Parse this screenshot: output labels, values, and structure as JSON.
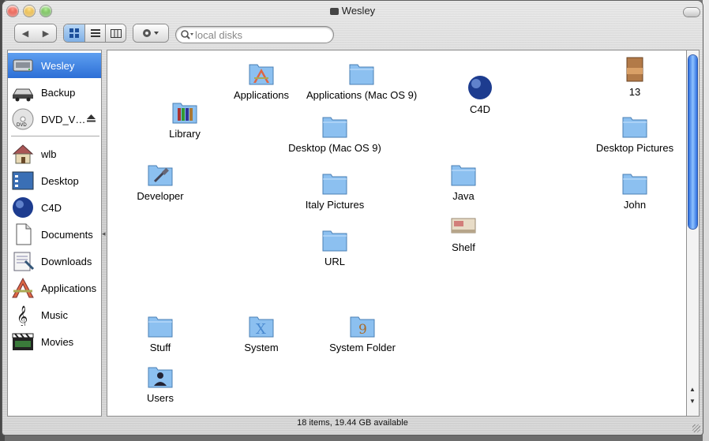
{
  "window": {
    "title": "Wesley"
  },
  "toolbar": {
    "back_label": "◀",
    "forward_label": "▶",
    "search_placeholder": "local disks"
  },
  "sidebar": {
    "devices": [
      {
        "label": "Wesley",
        "icon": "hard-drive-icon",
        "selected": true
      },
      {
        "label": "Backup",
        "icon": "external-drive-icon"
      },
      {
        "label": "DVD_V…",
        "icon": "dvd-icon",
        "ejectable": true
      }
    ],
    "places": [
      {
        "label": "wlb",
        "icon": "home-icon"
      },
      {
        "label": "Desktop",
        "icon": "desktop-icon"
      },
      {
        "label": "C4D",
        "icon": "c4d-icon"
      },
      {
        "label": "Documents",
        "icon": "documents-icon"
      },
      {
        "label": "Downloads",
        "icon": "downloads-icon"
      },
      {
        "label": "Applications",
        "icon": "applications-icon"
      },
      {
        "label": "Music",
        "icon": "music-icon"
      },
      {
        "label": "Movies",
        "icon": "movies-icon"
      }
    ]
  },
  "files": [
    {
      "label": "Applications",
      "icon": "applications-folder-icon"
    },
    {
      "label": "Applications (Mac OS 9)",
      "icon": "folder-icon"
    },
    {
      "label": "C4D",
      "icon": "c4d-icon"
    },
    {
      "label": "13",
      "icon": "image-file-icon"
    },
    {
      "label": "Library",
      "icon": "library-folder-icon"
    },
    {
      "label": "Desktop (Mac OS 9)",
      "icon": "folder-icon"
    },
    {
      "label": "Desktop Pictures",
      "icon": "folder-icon"
    },
    {
      "label": "Developer",
      "icon": "developer-folder-icon"
    },
    {
      "label": "Italy Pictures",
      "icon": "folder-icon"
    },
    {
      "label": "Java",
      "icon": "folder-icon"
    },
    {
      "label": "John",
      "icon": "folder-icon"
    },
    {
      "label": "Shelf",
      "icon": "shelf-icon"
    },
    {
      "label": "URL",
      "icon": "folder-icon"
    },
    {
      "label": "Stuff",
      "icon": "folder-icon"
    },
    {
      "label": "System",
      "icon": "system-folder-icon"
    },
    {
      "label": "System Folder",
      "icon": "system-folder-os9-icon"
    },
    {
      "label": "Users",
      "icon": "users-folder-icon"
    }
  ],
  "status": {
    "text": "18 items, 19.44 GB available"
  },
  "colors": {
    "selection": "#3a7fe0",
    "folder": "#8cc0f0"
  }
}
